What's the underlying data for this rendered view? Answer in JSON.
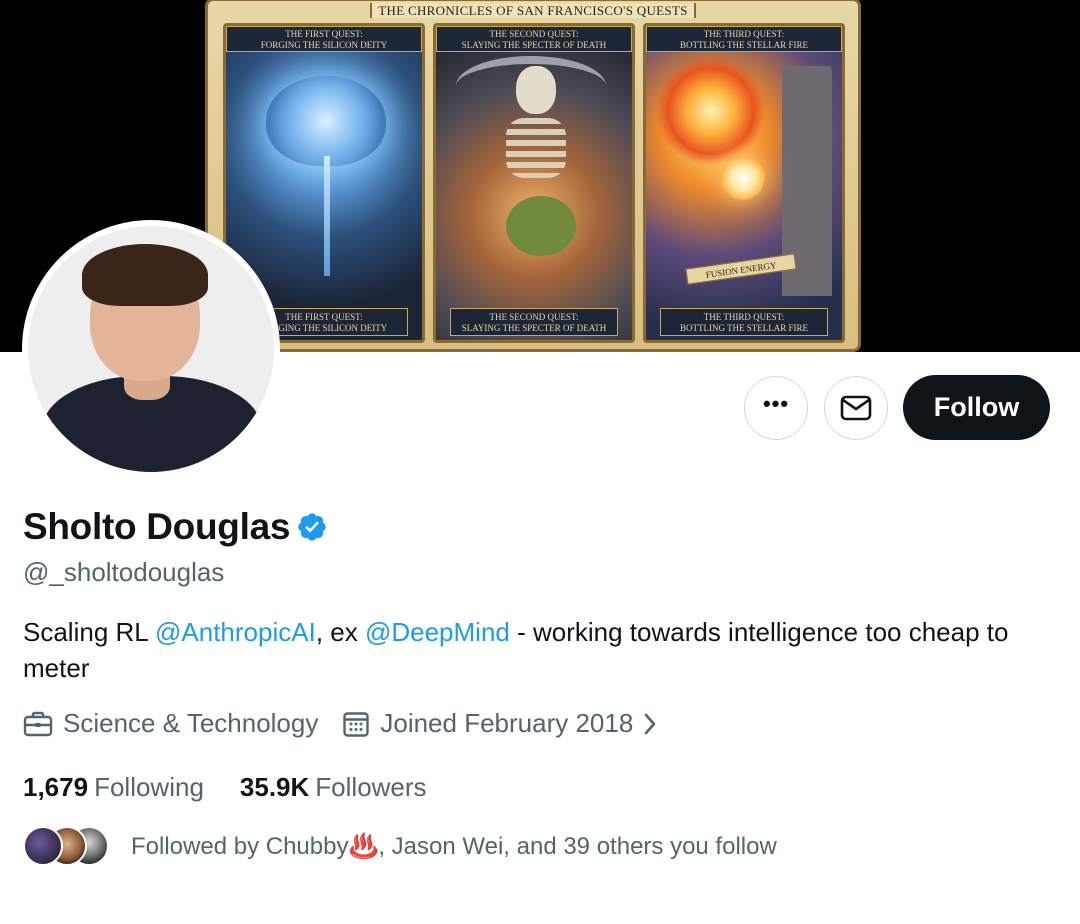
{
  "banner": {
    "title": "THE CHRONICLES OF SAN FRANCISCO'S QUESTS",
    "panels": [
      {
        "top_caption_1": "THE FIRST QUEST:",
        "top_caption_2": "FORGING THE SILICON DEITY",
        "bottom_caption_1": "THE FIRST QUEST:",
        "bottom_caption_2": "FORGING THE SILICON DEITY"
      },
      {
        "top_caption_1": "THE SECOND QUEST:",
        "top_caption_2": "SLAYING THE SPECTER OF DEATH",
        "bottom_caption_1": "THE SECOND QUEST:",
        "bottom_caption_2": "SLAYING THE SPECTER OF DEATH"
      },
      {
        "top_caption_1": "THE THIRD QUEST:",
        "top_caption_2": "BOTTLING THE STELLAR FIRE",
        "bottom_caption_1": "THE THIRD QUEST:",
        "bottom_caption_2": "BOTTLING THE STELLAR FIRE",
        "scroll_label": "FUSION ENERGY"
      }
    ]
  },
  "actions": {
    "more_icon": "more-icon",
    "more_glyph": "•••",
    "message_icon": "envelope-icon",
    "follow_label": "Follow"
  },
  "profile": {
    "name": "Sholto Douglas",
    "verified_icon": "verified-badge-icon",
    "handle": "@_sholtodouglas",
    "bio": {
      "part1": "Scaling RL ",
      "link1": "@AnthropicAI",
      "part2": ", ex ",
      "link2": "@DeepMind",
      "part3": " - working towards intelligence too cheap to meter"
    },
    "category": "Science & Technology",
    "category_icon": "briefcase-icon",
    "joined": "Joined February 2018",
    "joined_icon": "calendar-icon",
    "following_count": "1,679",
    "following_label": "Following",
    "followers_count": "35.9K",
    "followers_label": "Followers",
    "followed_by_prefix": "Followed by Chubby",
    "followed_by_emoji": "♨️",
    "followed_by_suffix": ", Jason Wei, and 39 others you follow"
  },
  "colors": {
    "accent": "#1d9bf0",
    "text_primary": "#0f1419",
    "text_secondary": "#536471",
    "follow_button": "#0f1419"
  }
}
